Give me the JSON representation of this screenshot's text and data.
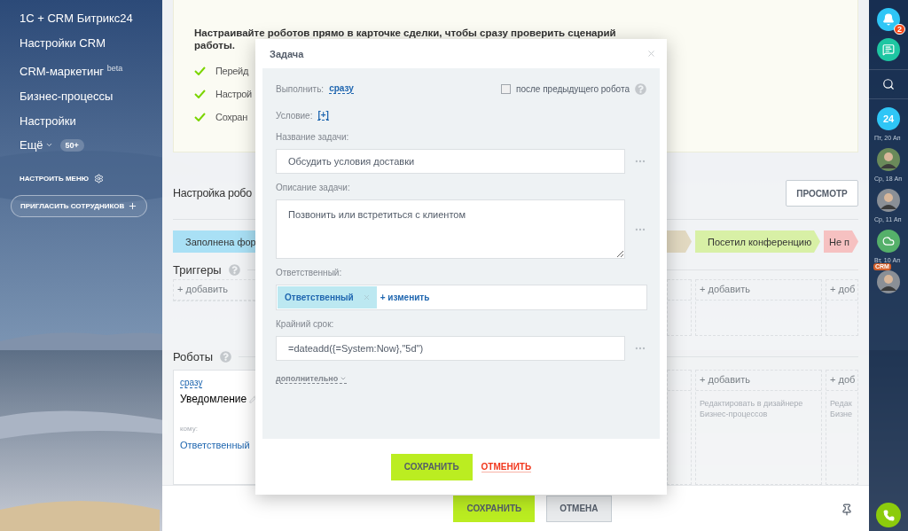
{
  "sidebar": {
    "items": [
      {
        "label": "1C + CRM Битрикс24"
      },
      {
        "label": "Настройки CRM"
      },
      {
        "label": "CRM-маркетинг",
        "sup": "beta"
      },
      {
        "label": "Бизнес-процессы"
      },
      {
        "label": "Настройки"
      }
    ],
    "more": {
      "label": "Ещё",
      "count": "50+"
    },
    "configure": "НАСТРОИТЬ МЕНЮ",
    "invite": "ПРИГЛАСИТЬ СОТРУДНИКОВ"
  },
  "info": {
    "text": "Настраивайте роботов прямо в карточке сделки, чтобы сразу проверить сценарий работы.",
    "steps": [
      "Перейд",
      "Настрой",
      "Сохран"
    ]
  },
  "heading": "Настройка робо",
  "preview": "ПРОСМОТР",
  "stages_left": [
    {
      "label": "Заполнена фор",
      "color": "#a9e0f5"
    }
  ],
  "stages_right": [
    {
      "color": "#e2d9c1"
    },
    {
      "label": "Посетил конференцию",
      "color": "#d8f0a6"
    },
    {
      "label": "Не п",
      "color": "#f6c1c1"
    }
  ],
  "triggers": {
    "title": "Триггеры",
    "left_add": "+ добавить",
    "right": [
      {
        "add": "+ добавить"
      },
      {
        "add": "+ доб"
      }
    ]
  },
  "robots": {
    "title": "Роботы",
    "card": {
      "delay": "сразу",
      "title": "Уведомление",
      "to_label": "кому:",
      "to_value": "Ответственный"
    },
    "right": [
      {
        "add": "+ добавить",
        "hint": [
          "Редактировать в дизайнере",
          "Бизнес-процессов"
        ]
      },
      {
        "add": "+ доб",
        "hint": [
          "Редак",
          "Бизне"
        ]
      }
    ]
  },
  "footer": {
    "save": "СОХРАНИТЬ",
    "cancel": "ОТМЕНА"
  },
  "rightbar": {
    "notifications": "2",
    "items": [
      {
        "kind": "app",
        "label": "24",
        "date": "Пт, 20 Ап"
      },
      {
        "kind": "avatar",
        "date": "Ср, 18 Ап"
      },
      {
        "kind": "avatar",
        "date": "Ср, 11 Ап"
      },
      {
        "kind": "cloud",
        "date": "Вт, 10 Ап"
      },
      {
        "kind": "avatar",
        "badge": "CRM"
      }
    ]
  },
  "dialog": {
    "title": "Задача",
    "run_label": "Выполнить:",
    "run_value": "сразу",
    "after_previous": {
      "label": "после предыдущего робота",
      "checked": false
    },
    "condition_label": "Условие:",
    "condition_value": "[+]",
    "fields": [
      {
        "kind": "input",
        "label": "Название задачи:",
        "value": "Обсудить условия доставки"
      },
      {
        "kind": "textarea",
        "label": "Описание задачи:",
        "value": "Позвонить или встретиться с клиентом"
      },
      {
        "kind": "user",
        "label": "Ответственный:",
        "chip": "Ответственный",
        "action": "+ изменить"
      },
      {
        "kind": "input",
        "label": "Крайний срок:",
        "value": "=dateadd({=System:Now},\"5d\")"
      }
    ],
    "more": "дополнительно",
    "save": "СОХРАНИТЬ",
    "cancel": "ОТМЕНИТЬ"
  }
}
